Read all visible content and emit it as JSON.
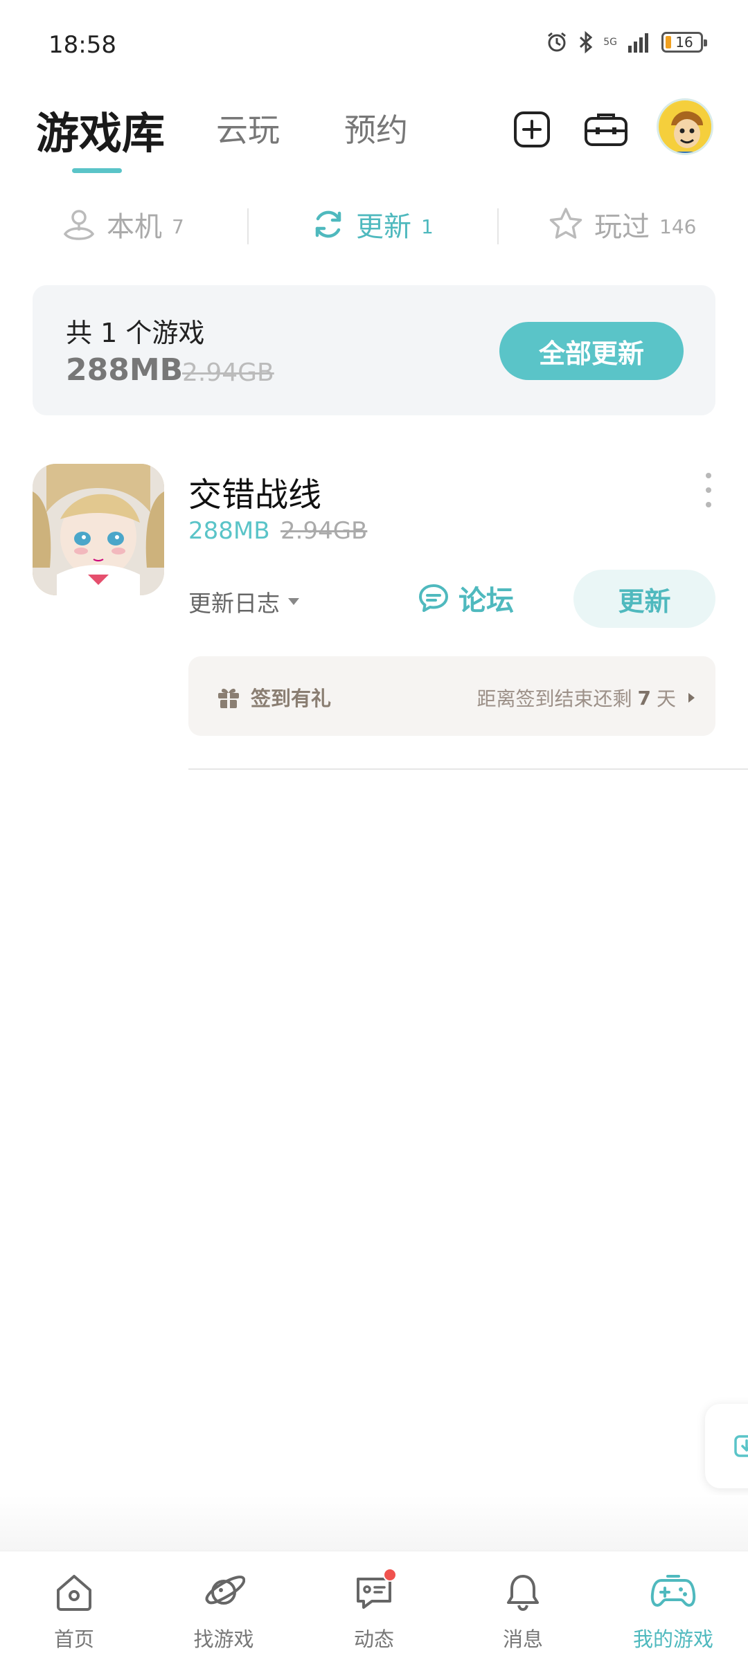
{
  "status_bar": {
    "time": "18:58",
    "network": "5G",
    "battery": "16"
  },
  "header": {
    "tabs": [
      {
        "label": "游戏库",
        "active": true
      },
      {
        "label": "云玩",
        "active": false
      },
      {
        "label": "预约",
        "active": false
      }
    ],
    "icons": [
      "add-icon",
      "toolbox-icon",
      "avatar"
    ]
  },
  "subtabs": [
    {
      "label": "本机",
      "count": "7",
      "icon": "local-device-icon",
      "active": false
    },
    {
      "label": "更新",
      "count": "1",
      "icon": "refresh-icon",
      "active": true
    },
    {
      "label": "玩过",
      "count": "146",
      "icon": "star-icon",
      "active": false
    }
  ],
  "summary": {
    "title": "共 1 个游戏",
    "download_size": "288MB",
    "full_size": "2.94GB",
    "update_all_label": "全部更新"
  },
  "game": {
    "name": "交错战线",
    "download_size": "288MB",
    "full_size": "2.94GB",
    "changelog_label": "更新日志",
    "forum_label": "论坛",
    "update_label": "更新",
    "signin": {
      "label": "签到有礼",
      "remaining_prefix": "距离签到结束还剩",
      "days": "7",
      "unit": "天"
    }
  },
  "bottom_nav": [
    {
      "label": "首页",
      "icon": "home-icon",
      "active": false
    },
    {
      "label": "找游戏",
      "icon": "planet-icon",
      "active": false
    },
    {
      "label": "动态",
      "icon": "chat-icon",
      "active": false,
      "badge": true
    },
    {
      "label": "消息",
      "icon": "bell-icon",
      "active": false
    },
    {
      "label": "我的游戏",
      "icon": "gamepad-icon",
      "active": true
    }
  ],
  "colors": {
    "accent": "#5ac4c8",
    "badge": "#f0524e",
    "text_primary": "#222222",
    "text_muted": "#aaaaaa"
  }
}
